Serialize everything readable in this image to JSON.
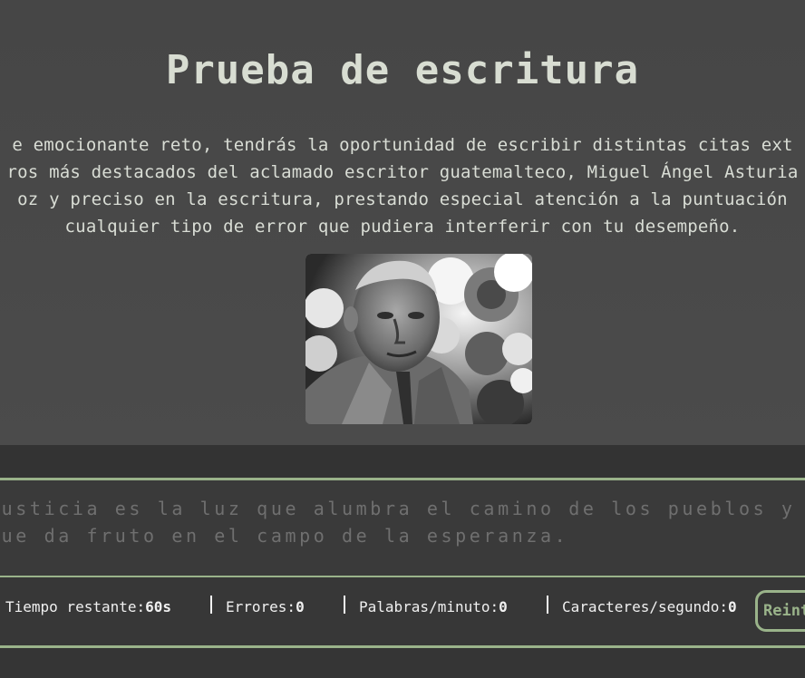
{
  "header": {
    "title": "Prueba de escritura",
    "intro_lines": [
      "e emocionante reto, tendrás la oportunidad de escribir distintas citas ext",
      "ros más destacados del aclamado escritor guatemalteco, Miguel Ángel Asturia",
      "oz y preciso en la escritura, prestando especial atención a la puntuación",
      "cualquier tipo de error que pudiera interferir con tu desempeño."
    ],
    "portrait_icon": "author-portrait-photo"
  },
  "test": {
    "quote_lines": [
      "justicia es la luz que alumbra el camino de los pueblos y la s",
      "que da fruto en el campo de la esperanza."
    ]
  },
  "stats": {
    "time_label": "Tiempo restante:",
    "time_value": "60s",
    "errors_label": "Errores:",
    "errors_value": "0",
    "wpm_label": "Palabras/minuto:",
    "wpm_value": "0",
    "cps_label": "Caracteres/segundo:",
    "cps_value": "0",
    "reset_label": "Reint"
  },
  "colors": {
    "accent": "#9ab38a",
    "background": "#383838",
    "title": "#d8ddd2"
  }
}
